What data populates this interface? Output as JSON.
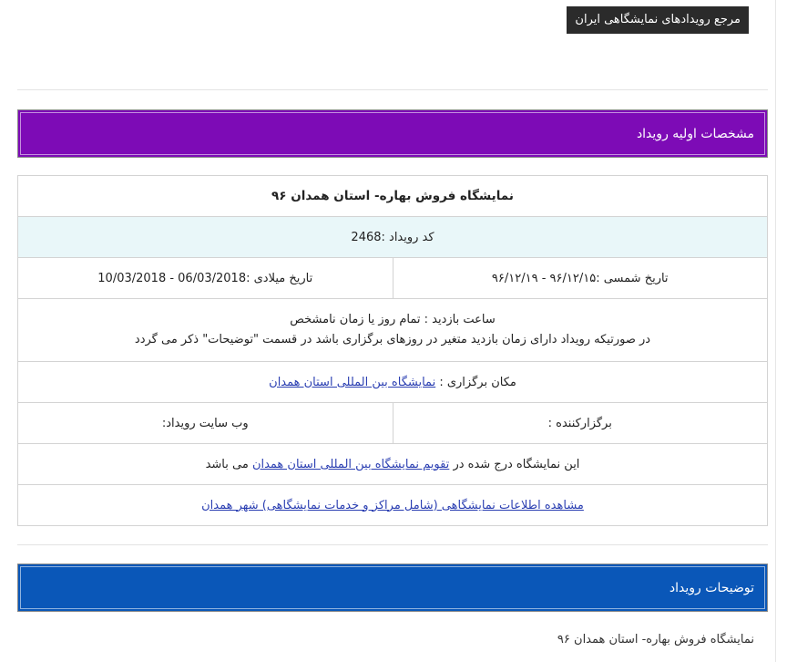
{
  "top_tag": "مرجع رویدادهای نمایشگاهی ایران",
  "section_basic": {
    "title": "مشخصات اولیه رویداد",
    "color": "#7d0bb6"
  },
  "event": {
    "name": "نمایشگاه فروش بهاره- استان همدان ۹۶",
    "code_label": "کد رویداد :",
    "code_value": "2468",
    "shamsi_label": "تاریخ شمسی :",
    "shamsi_value": "۹۶/۱۲/۱۵ - ۹۶/۱۲/۱۹",
    "miladi_label": "تاریخ میلادی :",
    "miladi_value": "10/03/2018 - 06/03/2018",
    "hours_line1": "ساعت بازدید : تمام روز یا زمان نامشخص",
    "hours_line2": "در صورتیکه رویداد دارای زمان بازدید متغیر در روزهای برگزاری باشد در قسمت \"توضیحات\" ذکر می گردد",
    "venue_label": "مکان برگزاری :",
    "venue_link": "نمایشگاه بین المللی استان همدان",
    "organizer_label": "برگزارکننده :",
    "website_label": "وب سایت رویداد:",
    "calendar_prefix": "این نمایشگاه درج شده در",
    "calendar_link": "تقویم نمایشگاه بین المللی استان همدان",
    "calendar_suffix": "می باشد",
    "city_link": "مشاهده اطلاعات نمایشگاهی (شامل مراکز و خدمات نمایشگاهی) شهر همدان"
  },
  "section_desc": {
    "title": "توضیحات رویداد",
    "color": "#0a57b8"
  },
  "description_text": "نمایشگاه فروش بهاره- استان همدان ۹۶"
}
